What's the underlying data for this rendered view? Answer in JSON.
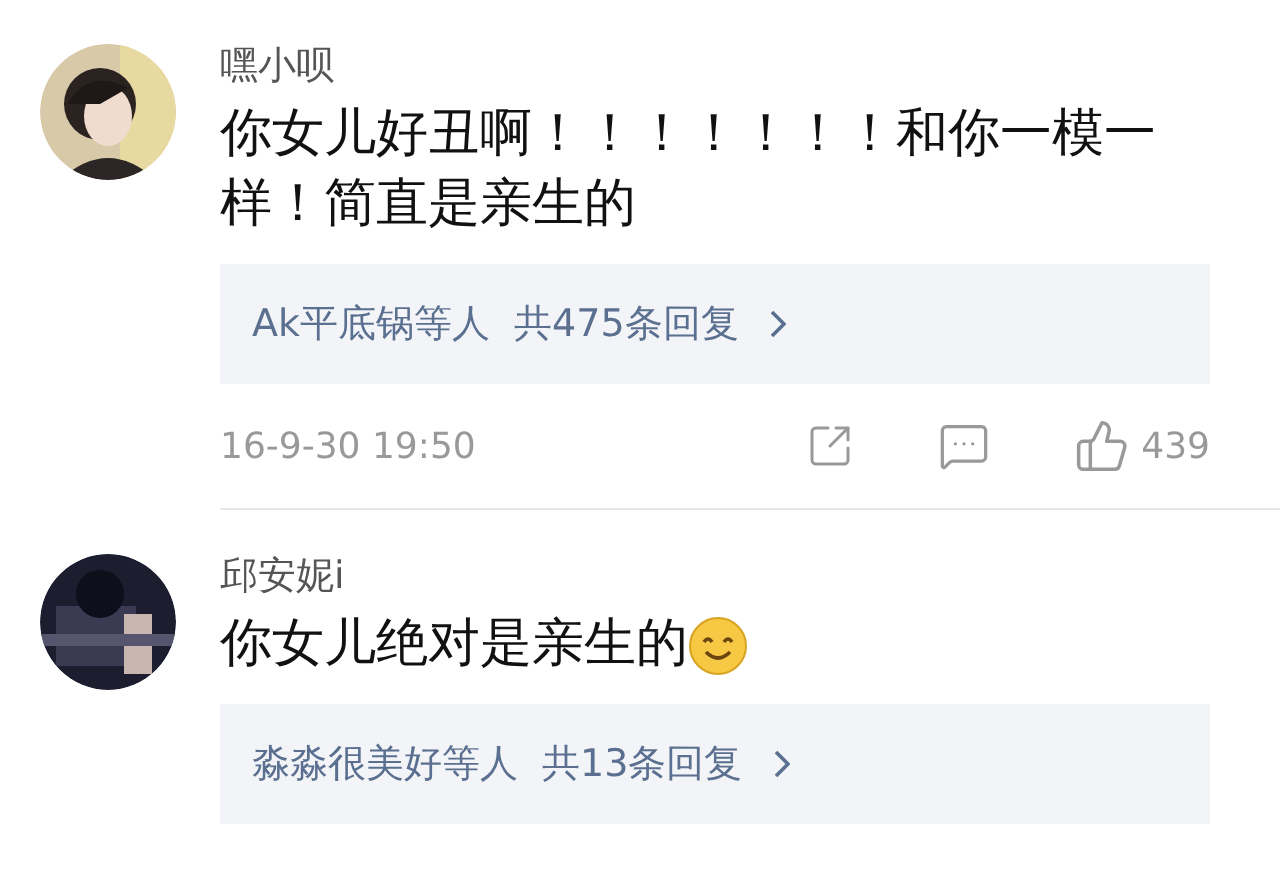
{
  "comments": [
    {
      "name": "嘿小呗",
      "text": "你女儿好丑啊！！！！！！！和你一模一样！简直是亲生的",
      "replies": {
        "names": "Ak平底锅等人",
        "count": "共475条回复"
      },
      "footer": {
        "date": "16-9-30 19:50",
        "likes": "439"
      }
    },
    {
      "name": "邱安妮i",
      "text": "你女儿绝对是亲生的",
      "emoji": true,
      "replies": {
        "names": "淼淼很美好等人",
        "count": "共13条回复"
      }
    }
  ]
}
